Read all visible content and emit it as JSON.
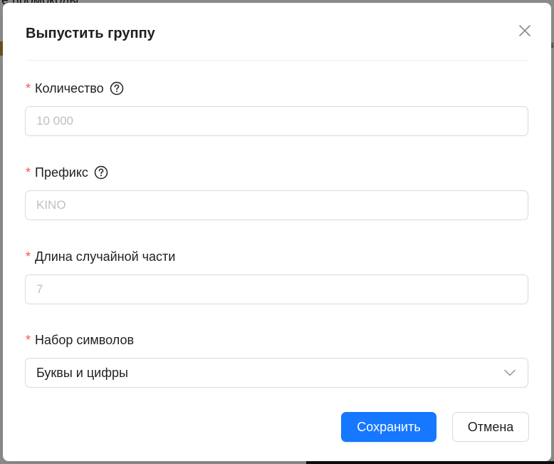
{
  "background": {
    "heading": "е промокоды",
    "menu_glyph": "≡"
  },
  "modal": {
    "title": "Выпустить группу",
    "fields": [
      {
        "label": "Количество",
        "required_mark": "*",
        "placeholder": "10 000",
        "help": true
      },
      {
        "label": "Префикс",
        "required_mark": "*",
        "placeholder": "KINO",
        "help": true
      },
      {
        "label": "Длина случайной части",
        "required_mark": "*",
        "placeholder": "7",
        "help": false
      }
    ],
    "charset": {
      "label": "Набор символов",
      "required_mark": "*",
      "selected": "Буквы и цифры"
    },
    "buttons": {
      "save": "Сохранить",
      "cancel": "Отмена"
    }
  },
  "colors": {
    "primary": "#1677ff",
    "required": "#ff4d4f",
    "border": "#d9d9d9",
    "placeholder": "#bfbfbf"
  },
  "icons": {
    "close": "close-icon",
    "help": "question-circle-icon",
    "dropdown": "chevron-down-icon"
  }
}
